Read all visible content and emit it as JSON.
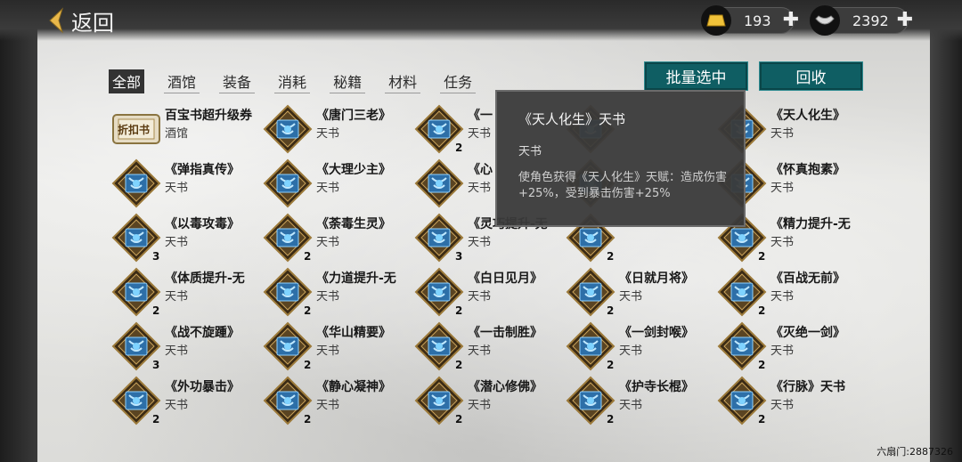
{
  "header": {
    "back_label": "返回"
  },
  "currencies": [
    {
      "name": "gold-bar",
      "value": "193"
    },
    {
      "name": "silver-ingot",
      "value": "2392"
    }
  ],
  "tabs": [
    "全部",
    "酒馆",
    "装备",
    "消耗",
    "秘籍",
    "材料",
    "任务"
  ],
  "active_tab": 0,
  "buttons": {
    "batch_select": "批量选中",
    "recycle": "回收"
  },
  "items": [
    {
      "name": "百宝书超升级券",
      "cat": "酒馆",
      "count": "",
      "coupon": true,
      "coupon_text": "折扣书"
    },
    {
      "name": "《唐门三老》",
      "cat": "天书",
      "count": ""
    },
    {
      "name": "《一",
      "cat": "天书",
      "count": "2"
    },
    {
      "name": "",
      "cat": "",
      "count": ""
    },
    {
      "name": "《天人化生》",
      "cat": "天书",
      "count": ""
    },
    {
      "name": "《弹指真传》",
      "cat": "天书",
      "count": ""
    },
    {
      "name": "《大理少主》",
      "cat": "天书",
      "count": ""
    },
    {
      "name": "《心",
      "cat": "天书",
      "count": ""
    },
    {
      "name": "",
      "cat": "",
      "count": ""
    },
    {
      "name": "《怀真抱素》",
      "cat": "天书",
      "count": ""
    },
    {
      "name": "《以毒攻毒》",
      "cat": "天书",
      "count": "3"
    },
    {
      "name": "《荼毒生灵》",
      "cat": "天书",
      "count": "2"
    },
    {
      "name": "《灵巧提升-无",
      "cat": "天书",
      "count": "3"
    },
    {
      "name": "",
      "cat": "",
      "count": "2"
    },
    {
      "name": "《精力提升-无",
      "cat": "天书",
      "count": "2"
    },
    {
      "name": "《体质提升-无",
      "cat": "天书",
      "count": "2"
    },
    {
      "name": "《力道提升-无",
      "cat": "天书",
      "count": "2"
    },
    {
      "name": "《白日见月》",
      "cat": "天书",
      "count": "2"
    },
    {
      "name": "《日就月将》",
      "cat": "天书",
      "count": "2"
    },
    {
      "name": "《百战无前》",
      "cat": "天书",
      "count": "2"
    },
    {
      "name": "《战不旋踵》",
      "cat": "天书",
      "count": "3"
    },
    {
      "name": "《华山精要》",
      "cat": "天书",
      "count": "2"
    },
    {
      "name": "《一击制胜》",
      "cat": "天书",
      "count": "2"
    },
    {
      "name": "《一剑封喉》",
      "cat": "天书",
      "count": "2"
    },
    {
      "name": "《灭绝一剑》",
      "cat": "天书",
      "count": "2"
    },
    {
      "name": "《外功暴击》",
      "cat": "天书",
      "count": "2"
    },
    {
      "name": "《静心凝神》",
      "cat": "天书",
      "count": "2"
    },
    {
      "name": "《潜心修佛》",
      "cat": "天书",
      "count": "2"
    },
    {
      "name": "《护寺长棍》",
      "cat": "天书",
      "count": "2"
    },
    {
      "name": "《行脉》天书",
      "cat": "天书",
      "count": "2"
    }
  ],
  "tooltip": {
    "title": "《天人化生》天书",
    "cat": "天书",
    "desc": "使角色获得《天人化生》天赋：造成伤害+25%，受到暴击伤害+25%"
  },
  "watermark": "六扇门:2887326",
  "colors": {
    "button_bg": "#0f5e63",
    "tooltip_bg": "#3a3a3a"
  }
}
